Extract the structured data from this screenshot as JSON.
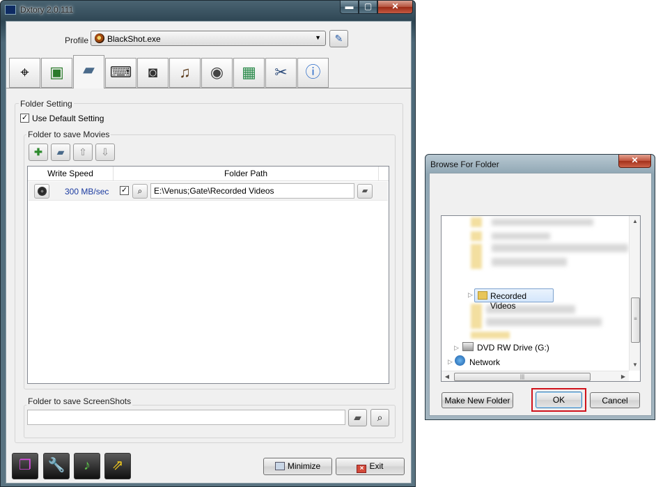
{
  "dxtory": {
    "title": "Dxtory 2.0.111",
    "caption_buttons": {
      "minimize": "▬",
      "maximize": "▢",
      "close": "✕"
    },
    "profile": {
      "label": "Profile",
      "value": "BlackShot.exe",
      "edit_icon": "pencil-icon"
    },
    "tabs": [
      {
        "icon": "crosshair-icon",
        "glyph": "⌖"
      },
      {
        "icon": "monitor-icon",
        "glyph": "▣"
      },
      {
        "icon": "folder-icon",
        "glyph": "▰",
        "active": true
      },
      {
        "icon": "keyboard-icon",
        "glyph": "⌨"
      },
      {
        "icon": "camcorder-icon",
        "glyph": "◙"
      },
      {
        "icon": "audio-icon",
        "glyph": "♫"
      },
      {
        "icon": "camera-icon",
        "glyph": "◉"
      },
      {
        "icon": "chip-icon",
        "glyph": "▦"
      },
      {
        "icon": "tools-icon",
        "glyph": "✂"
      },
      {
        "icon": "info-icon",
        "glyph": "ⓘ"
      }
    ],
    "folder_setting": {
      "label": "Folder Setting",
      "use_default": {
        "label": "Use Default Setting",
        "checked": true
      },
      "movies": {
        "label": "Folder to save Movies",
        "columns": [
          "Write Speed",
          "Folder Path"
        ],
        "rows": [
          {
            "write_speed": "300 MB/sec",
            "enabled": true,
            "path": "E:\\Venus;Gate\\Recorded Videos"
          }
        ]
      },
      "screenshots": {
        "label": "Folder to save ScreenShots",
        "path": ""
      }
    },
    "bottom_buttons": {
      "minimize": "Minimize",
      "exit": "Exit"
    }
  },
  "browse_dialog": {
    "title": "Browse For Folder",
    "tree": {
      "selected": "Recorded Videos",
      "drive": "DVD RW Drive (G:)",
      "network": "Network"
    },
    "buttons": {
      "new_folder": "Make New Folder",
      "ok": "OK",
      "cancel": "Cancel"
    }
  }
}
